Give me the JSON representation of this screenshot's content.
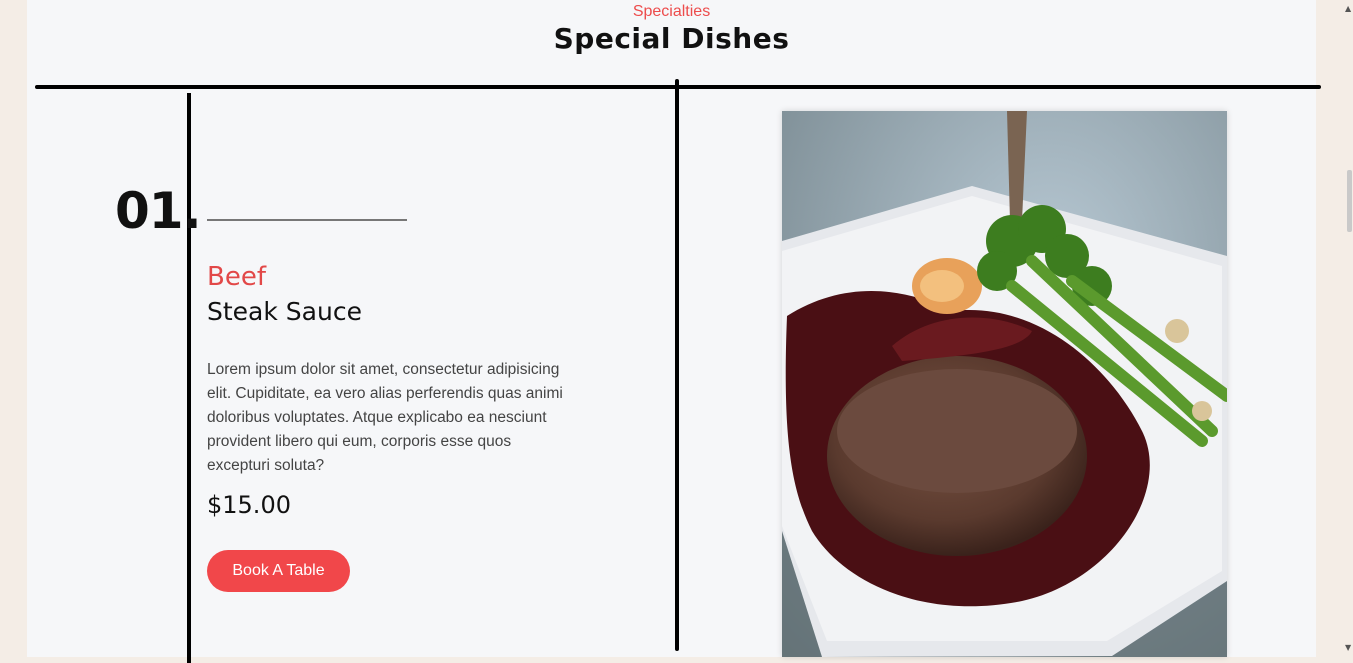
{
  "section": {
    "subtitle": "Specialties",
    "title": "Special Dishes"
  },
  "dish": {
    "number": "01.",
    "category": "Beef",
    "name": "Steak Sauce",
    "description": "Lorem ipsum dolor sit amet, consectetur adipisicing elit. Cupiditate, ea vero alias perferendis quas animi doloribus voluptates. Atque explicabo ea nesciunt provident libero qui eum, corporis esse quos excepturi soluta?",
    "price": "$15.00",
    "book_button": "Book A Table",
    "image_icon": "steak-photo"
  },
  "colors": {
    "accent": "#ed4c4c",
    "button": "#f1474a",
    "background": "#f6f7f9"
  }
}
